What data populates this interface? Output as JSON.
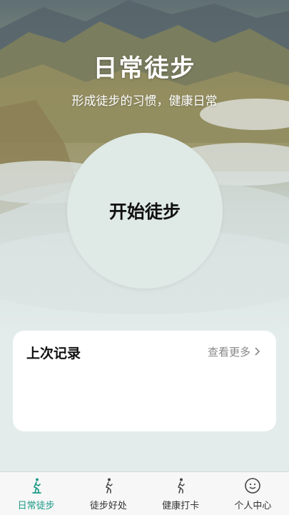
{
  "hero": {
    "title": "日常徒步",
    "subtitle": "形成徒步的习惯，健康日常",
    "start_button": "开始徒步"
  },
  "record": {
    "title": "上次记录",
    "more_label": "查看更多",
    "more_icon": "chevron-right-icon"
  },
  "tabbar": {
    "active_color": "#1c9a86",
    "items": [
      {
        "label": "日常徒步",
        "icon": "walking-person-icon",
        "active": true
      },
      {
        "label": "徒步好处",
        "icon": "walking-person-icon",
        "active": false
      },
      {
        "label": "健康打卡",
        "icon": "walking-person-icon",
        "active": false
      },
      {
        "label": "个人中心",
        "icon": "smiley-face-icon",
        "active": false
      }
    ]
  }
}
